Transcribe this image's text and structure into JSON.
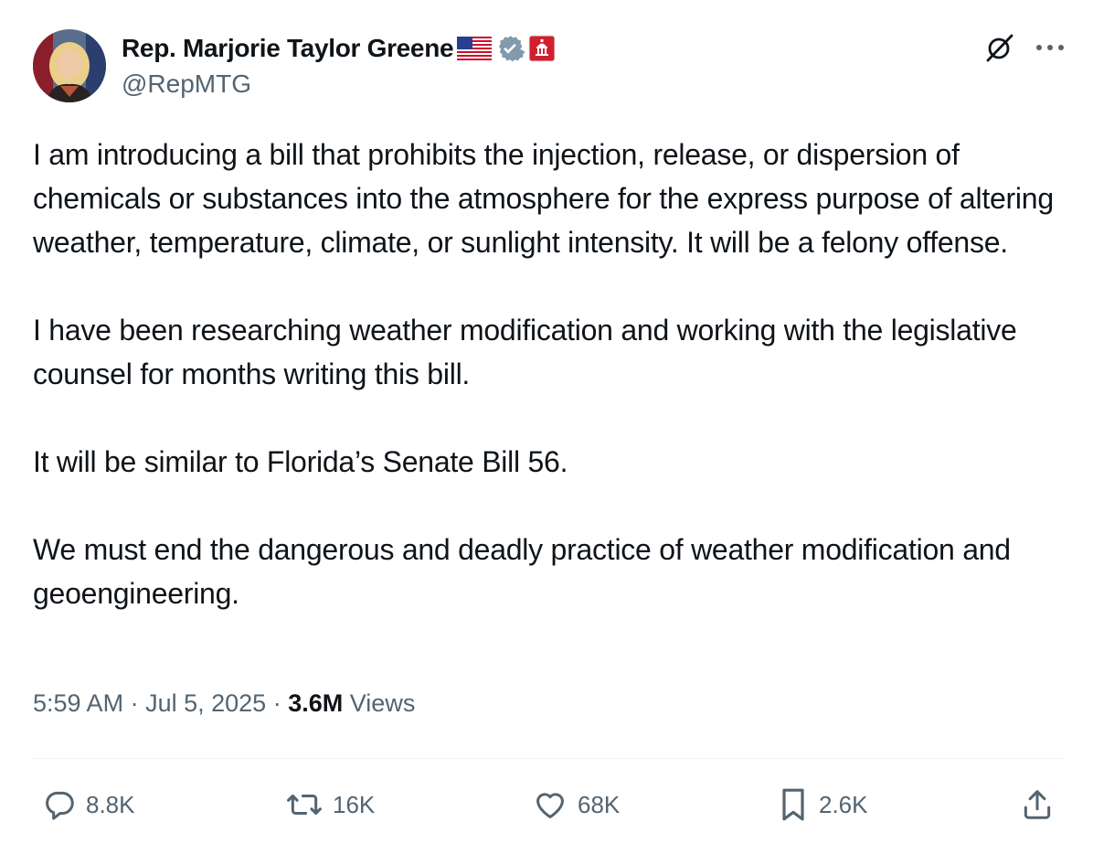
{
  "author": {
    "display_name": "Rep. Marjorie Taylor Greene",
    "handle": "@RepMTG",
    "flag_emoji": "us-flag-icon",
    "verified_badge": "gray-verified-badge-icon",
    "affiliation_badge": "us-capitol-affiliation-icon"
  },
  "top_actions": {
    "grok_icon": "grok-icon",
    "more_icon": "more-icon"
  },
  "tweet": {
    "paragraphs": [
      "I am introducing a bill that prohibits the injection, release, or dispersion of chemicals or substances into the atmosphere for the express purpose of altering weather, temperature, climate, or sunlight intensity. It will be a felony offense.",
      "I have been researching weather modification and working with the legislative counsel for months writing this bill.",
      "It will be similar to Florida’s Senate Bill 56.",
      "We must end the dangerous and deadly practice of weather modification and geoengineering."
    ]
  },
  "meta": {
    "time": "5:59 AM",
    "separator": "·",
    "date": "Jul 5, 2025",
    "views_count": "3.6M",
    "views_label": "Views"
  },
  "engagement": {
    "replies": "8.8K",
    "reposts": "16K",
    "likes": "68K",
    "bookmarks": "2.6K"
  },
  "colors": {
    "text_primary": "#0f1419",
    "text_secondary": "#536471",
    "divider": "#eff3f4",
    "verified_gray": "#829aab",
    "affiliation_red": "#d0202f"
  }
}
